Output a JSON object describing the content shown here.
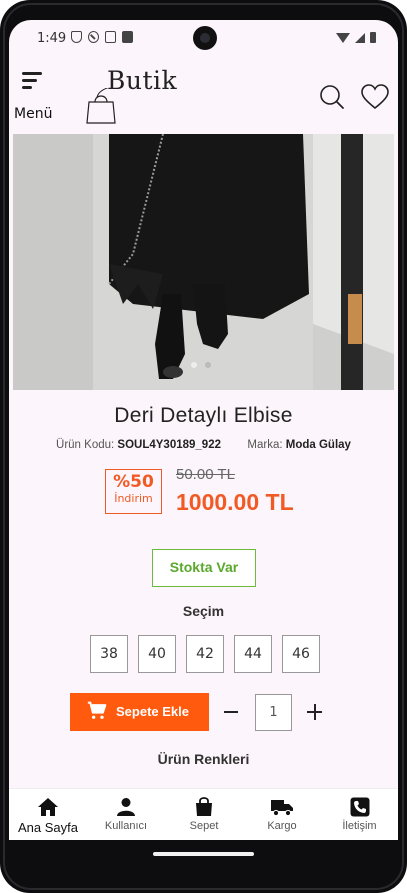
{
  "status_bar": {
    "time": "1:49"
  },
  "header": {
    "menu_label": "Menü",
    "logo_text": "Butik"
  },
  "product": {
    "title": "Deri Detaylı Elbise",
    "code_label": "Ürün Kodu:",
    "code_value": "SOUL4Y30189_922",
    "brand_label": "Marka:",
    "brand_value": "Moda Gülay",
    "discount_percent": "%50",
    "discount_label": "İndirim",
    "old_price": "50.00 TL",
    "new_price": "1000.00 TL",
    "stock_label": "Stokta Var",
    "image_dots": {
      "count": 2,
      "active_index": 1
    }
  },
  "selection": {
    "label": "Seçim",
    "sizes": [
      "38",
      "40",
      "42",
      "44",
      "46"
    ]
  },
  "cart": {
    "add_label": "Sepete Ekle",
    "quantity": "1"
  },
  "colors_label": "Ürün Renkleri",
  "bottom_nav": {
    "items": [
      {
        "label": "Ana Sayfa",
        "icon": "home-icon",
        "active": true
      },
      {
        "label": "Kullanıcı",
        "icon": "user-icon",
        "active": false
      },
      {
        "label": "Sepet",
        "icon": "shopping-bag-icon",
        "active": false
      },
      {
        "label": "Kargo",
        "icon": "truck-icon",
        "active": false
      },
      {
        "label": "İletişim",
        "icon": "phone-icon",
        "active": false
      }
    ]
  },
  "colors": {
    "accent": "#ff5a0d",
    "stock_green": "#6cbb3c",
    "background": "#fcf5fb"
  }
}
